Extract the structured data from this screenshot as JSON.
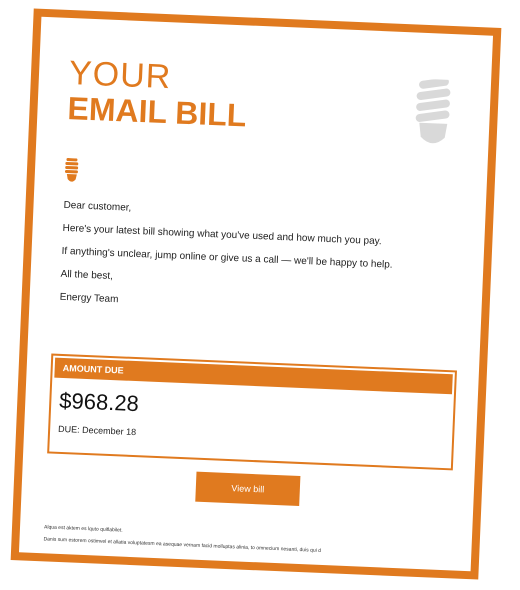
{
  "colors": {
    "accent": "#e07a1f",
    "icon_gray": "#d9d9d9"
  },
  "header": {
    "title_line1": "YOUR",
    "title_line2": "EMAIL BILL",
    "decor_icon": "lightbulb-icon"
  },
  "letter": {
    "greeting": "Dear customer,",
    "line1": "Here's your latest bill showing what you've used and how much you pay.",
    "line2": "If anything's unclear, jump online or give us a call — we'll be happy to help.",
    "signoff": "All the best,",
    "signature": "Energy Team"
  },
  "amount": {
    "header": "AMOUNT DUE",
    "value": "$968.28",
    "due": "DUE: December 18"
  },
  "actions": {
    "view_bill": "View bill"
  },
  "footer": {
    "line1": "Alqua est aktem es lquto quiflabilet.",
    "line2": "Danis sum estorem ostimvel et allatia voluptatesm ea asequae vernam facid molluptas alinia, to omnecium nesanti, duis qui d"
  }
}
